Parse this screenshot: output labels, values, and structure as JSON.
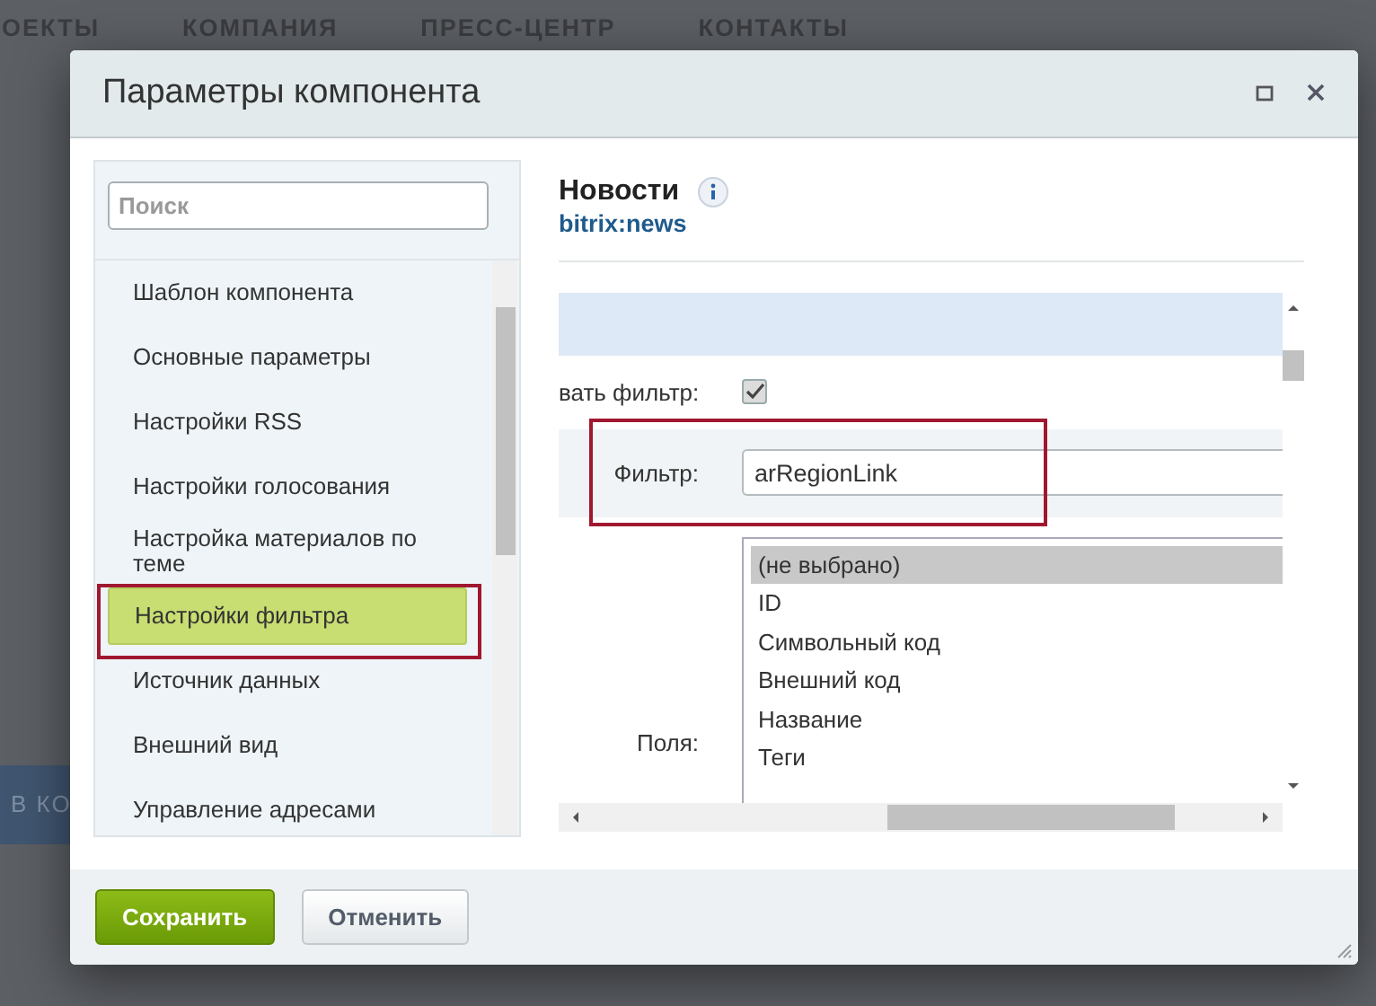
{
  "background": {
    "nav": [
      "ОЕКТЫ",
      "КОМПАНИЯ",
      "ПРЕСС-ЦЕНТР",
      "КОНТАКТЫ"
    ],
    "button_fragment": "В КО"
  },
  "dialog": {
    "title": "Параметры компонента",
    "search": {
      "placeholder": "Поиск"
    },
    "sections": [
      {
        "label": "Шаблон компонента",
        "selected": false,
        "highlighted": false
      },
      {
        "label": "Основные параметры",
        "selected": false,
        "highlighted": false
      },
      {
        "label": "Настройки RSS",
        "selected": false,
        "highlighted": false
      },
      {
        "label": "Настройки голосования",
        "selected": false,
        "highlighted": false
      },
      {
        "label": "Настройка материалов по теме",
        "selected": false,
        "highlighted": false
      },
      {
        "label": "Настройки фильтра",
        "selected": true,
        "highlighted": true
      },
      {
        "label": "Источник данных",
        "selected": false,
        "highlighted": false
      },
      {
        "label": "Внешний вид",
        "selected": false,
        "highlighted": false
      },
      {
        "label": "Управление адресами",
        "selected": false,
        "highlighted": false
      }
    ],
    "component": {
      "name": "Новости",
      "code": "bitrix:news"
    },
    "use_filter": {
      "label": "вать фильтр:",
      "checked": true
    },
    "filter": {
      "label": "Фильтр:",
      "value": "arRegionLink",
      "highlighted": true
    },
    "fields": {
      "label": "Поля:",
      "options": [
        {
          "label": "(не выбрано)",
          "selected": true
        },
        {
          "label": "ID",
          "selected": false
        },
        {
          "label": "Символьный код",
          "selected": false
        },
        {
          "label": "Внешний код",
          "selected": false
        },
        {
          "label": "Название",
          "selected": false
        },
        {
          "label": "Теги",
          "selected": false
        }
      ]
    },
    "buttons": [
      {
        "label": "Сохранить",
        "kind": "primary"
      },
      {
        "label": "Отменить",
        "kind": "secondary"
      }
    ]
  }
}
